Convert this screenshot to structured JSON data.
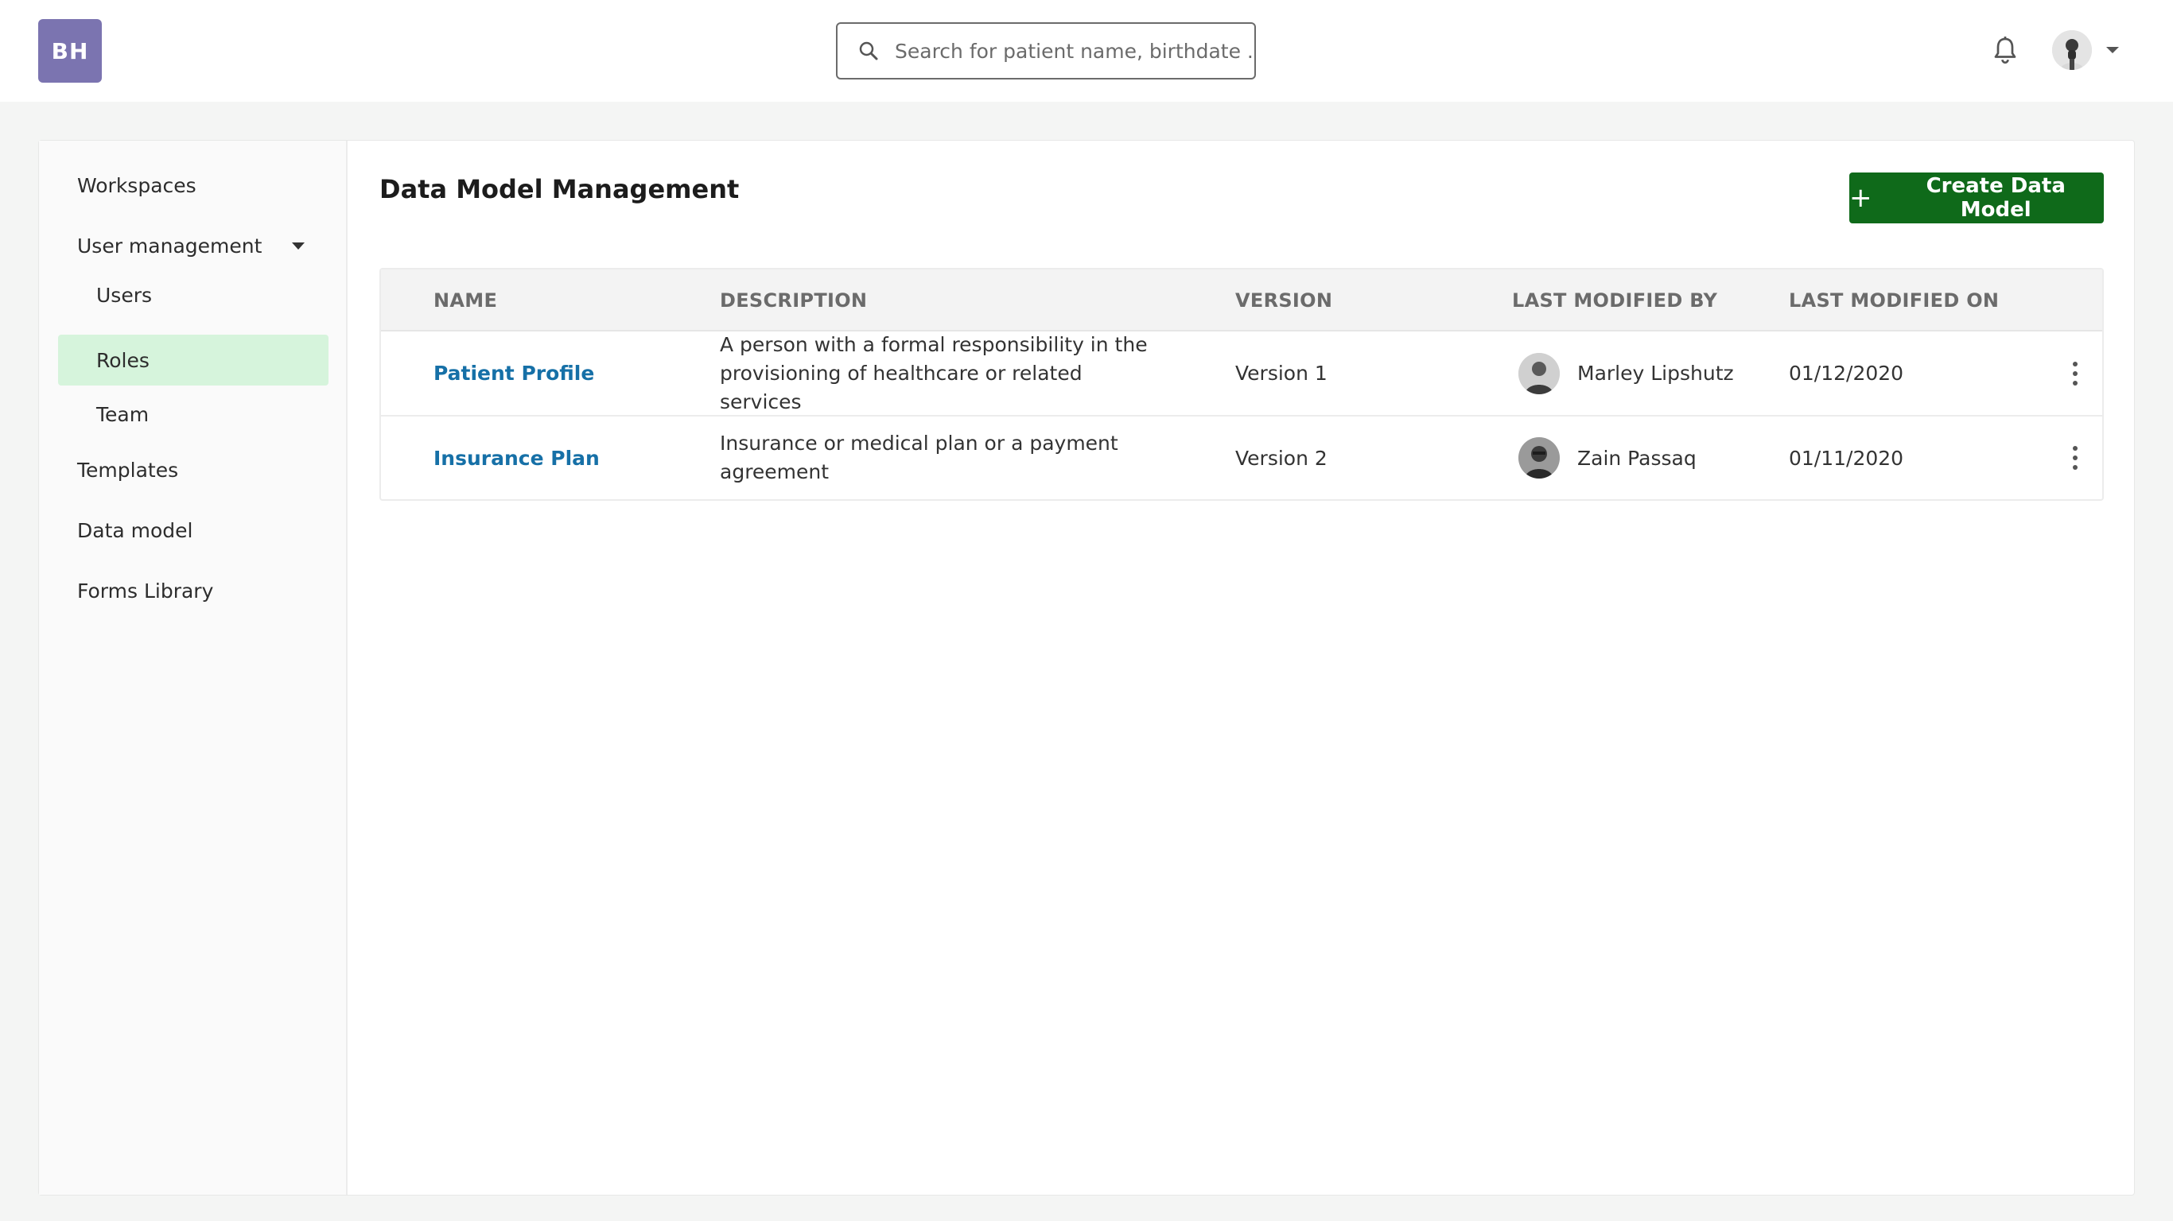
{
  "app": {
    "logo_text": "BH",
    "brand_color": "#7b74b0"
  },
  "search": {
    "placeholder": "Search for patient name, birthdate ...",
    "value": ""
  },
  "header": {
    "notifications_icon": "bell-icon",
    "user_avatar_icon": "user-avatar",
    "user_menu_icon": "chevron-down-icon"
  },
  "sidebar": {
    "items": [
      {
        "label": "Workspaces"
      },
      {
        "label": "User management",
        "expanded": true
      },
      {
        "label": "Templates"
      },
      {
        "label": "Data model"
      },
      {
        "label": "Forms Library"
      }
    ],
    "user_management_children": [
      {
        "label": "Users",
        "active": false
      },
      {
        "label": "Roles",
        "active": true
      },
      {
        "label": "Team",
        "active": false
      }
    ],
    "active_color": "#d6f4dc"
  },
  "main": {
    "title": "Data Model Management",
    "create_button": {
      "icon": "plus-icon",
      "label": "Create Data Model",
      "color": "#0f6a1a"
    },
    "table": {
      "columns": [
        "NAME",
        "DESCRIPTION",
        "VERSION",
        "LAST MODIFIED BY",
        "LAST MODIFIED ON"
      ],
      "rows": [
        {
          "name": "Patient Profile",
          "description": "A person with a formal responsibility in the provisioning of healthcare or related services",
          "version": "Version 1",
          "modified_by": "Marley Lipshutz",
          "modified_on": "01/12/2020"
        },
        {
          "name": "Insurance Plan",
          "description": "Insurance or medical plan or a payment agreement",
          "version": "Version 2",
          "modified_by": "Zain Passaq",
          "modified_on": "01/11/2020"
        }
      ],
      "link_color": "#1670a7"
    }
  }
}
